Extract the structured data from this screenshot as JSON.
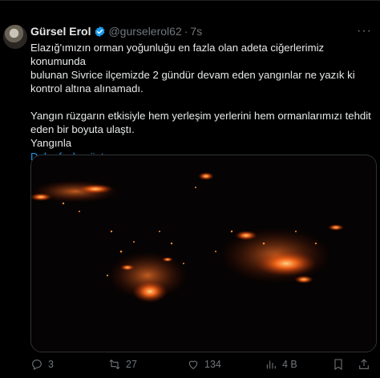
{
  "tweet": {
    "name": "Gürsel Erol",
    "handle": "@gurselerol62",
    "separator": "·",
    "time": "7s",
    "text_lines": [
      "Elazığ'ımızın orman yoğunluğu en fazla olan adeta ciğerlerimiz konumunda",
      "bulunan Sivrice ilçemizde 2 gündür devam eden yangınlar ne yazık ki",
      "kontrol altına alınamadı.",
      "Yangın rüzgarın etkisiyle hem yerleşim yerlerini hem ormanlarımızı tehdit",
      "eden bir boyuta ulaştı.",
      "Yangınla"
    ],
    "show_more": "Daha fazla göster"
  },
  "actions": {
    "replies": "3",
    "retweets": "27",
    "likes": "134",
    "views": "4 B"
  },
  "icons": {
    "verified": "verified-badge-icon",
    "more": "more-icon",
    "reply": "reply-icon",
    "retweet": "retweet-icon",
    "like": "heart-icon",
    "views": "views-chart-icon",
    "bookmark": "bookmark-icon",
    "share": "share-icon"
  },
  "colors": {
    "background": "#000000",
    "text": "#e7e9ea",
    "muted": "#71767b",
    "accent": "#1d9bf0",
    "fire": "#ff5a1f"
  }
}
